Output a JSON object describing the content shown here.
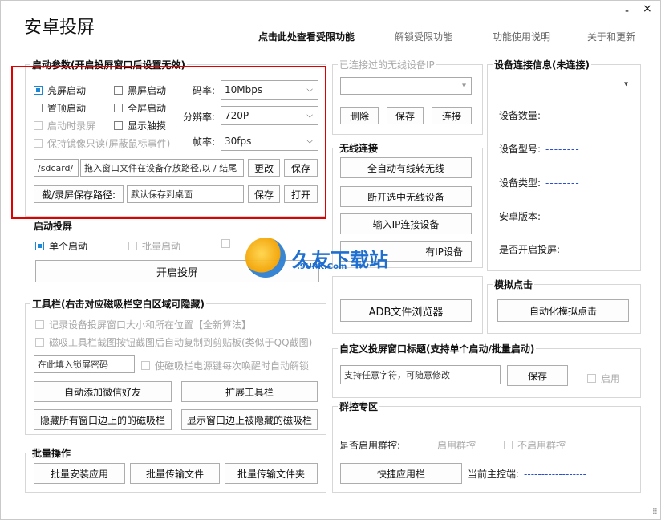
{
  "app": {
    "title": "安卓投屏",
    "nav": {
      "restricted_view": "点击此处查看受限功能",
      "unlock": "解锁受限功能",
      "help": "功能使用说明",
      "about": "关于和更新"
    },
    "minimize": "-",
    "close": "×"
  },
  "startup_params": {
    "legend": "启动参数(开启投屏窗口后设置无效)",
    "checks": {
      "bright": "亮屏启动",
      "black": "黑屏启动",
      "top": "置顶启动",
      "fullscreen": "全屏启动",
      "screen_off": "启动时录屏",
      "show_touch": "显示触摸",
      "readonly": "保持镜像只读(屏蔽鼠标事件)"
    },
    "bitrate_label": "码率:",
    "bitrate_value": "10Mbps",
    "resolution_label": "分辨率:",
    "resolution_value": "720P",
    "fps_label": "帧率:",
    "fps_value": "30fps",
    "path_prefix": "/sdcard/",
    "path_hint": "拖入窗口文件在设备存放路径,以 / 结尾",
    "change_btn": "更改",
    "save_btn": "保存",
    "capture_path_btn": "截/录屏保存路径:",
    "capture_path_value": "默认保存到桌面",
    "save_btn2": "保存",
    "open_btn": "打开"
  },
  "launch": {
    "title": "启动投屏",
    "single": "单个启动",
    "batch": "批量启动",
    "third": "",
    "start_btn": "开启投屏"
  },
  "toolbar": {
    "legend": "工具栏(右击对应磁吸栏空白区域可隐藏)",
    "record_size": "记录设备投屏窗口大小和所在位置【全新算法】",
    "snap_copy": "磁吸工具栏截图按钮截图后自动复制到剪贴板(类似于QQ截图)",
    "lock_pwd_placeholder": "在此填入锁屏密码",
    "auto_unlock": "使磁吸栏电源键每次唤醒时自动解锁",
    "add_wechat": "自动添加微信好友",
    "extend_toolbar": "扩展工具栏",
    "hide_bars": "隐藏所有窗口边上的的磁吸栏",
    "show_bars": "显示窗口边上被隐藏的磁吸栏"
  },
  "batch": {
    "legend": "批量操作",
    "install": "批量安装应用",
    "transfer_file": "批量传输文件",
    "transfer_folder": "批量传输文件夹"
  },
  "wireless": {
    "legend": "已连接过的无线设备IP",
    "delete_btn": "删除",
    "save_btn": "保存",
    "connect_btn": "连接",
    "title": "无线连接",
    "auto_btn": "全自动有线转无线",
    "disconnect_btn": "断开选中无线设备",
    "input_ip_btn": "输入IP连接设备",
    "scan_btn": "有IP设备"
  },
  "file_transfer": {
    "adb_btn": "ADB文件浏览器"
  },
  "device_info": {
    "legend": "设备连接信息(未连接)",
    "count_label": "设备数量:",
    "model_label": "设备型号:",
    "type_label": "设备类型:",
    "version_label": "安卓版本:",
    "projecting_label": "是否开启投屏:",
    "dash": "--------"
  },
  "simulate": {
    "legend": "模拟点击",
    "auto_btn": "自动化模拟点击"
  },
  "custom_title": {
    "legend": "自定义投屏窗口标题(支持单个启动/批量启动)",
    "input_value": "支持任意字符，可随意修改",
    "save_btn": "保存",
    "enable": "启用"
  },
  "group": {
    "legend": "群控专区",
    "enable_label": "是否启用群控:",
    "enable_opt": "启用群控",
    "disable_opt": "不启用群控",
    "quick_btn": "快捷应用栏",
    "master_label": "当前主控端:",
    "master_value": "------------------"
  },
  "watermark": {
    "text": "久友下载站",
    "sub": ".9UPK.Com"
  }
}
